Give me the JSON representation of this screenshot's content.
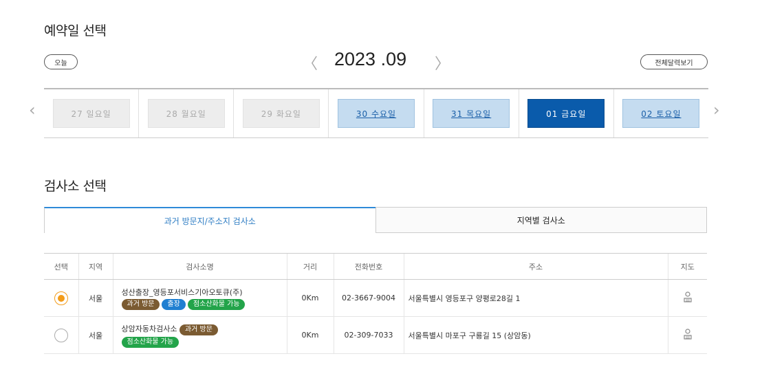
{
  "date_section": {
    "title": "예약일 선택",
    "today_button": "오늘",
    "month_label": "2023 .09",
    "prev_month_glyph": "〈",
    "next_month_glyph": "〉",
    "full_calendar_button": "전체달력보기",
    "days": [
      {
        "label": "27  일요일",
        "state": "past"
      },
      {
        "label": "28  월요일",
        "state": "past"
      },
      {
        "label": "29  화요일",
        "state": "past"
      },
      {
        "label": "30  수요일",
        "state": "available"
      },
      {
        "label": "31  목요일",
        "state": "available"
      },
      {
        "label": "01  금요일",
        "state": "selected"
      },
      {
        "label": "02  토요일",
        "state": "available"
      }
    ]
  },
  "center_section": {
    "title": "검사소 선택",
    "tabs": [
      {
        "label": "과거 방문지/주소지 검사소",
        "active": true
      },
      {
        "label": "지역별 검사소",
        "active": false
      }
    ],
    "columns": [
      "선택",
      "지역",
      "검사소명",
      "거리",
      "전화번호",
      "주소",
      "지도"
    ],
    "rows": [
      {
        "selected": true,
        "region": "서울",
        "name": "성산출장_영등포서비스기아오토큐(주)",
        "badges": [
          {
            "text": "과거 방문",
            "kind": "past"
          },
          {
            "text": "출장",
            "kind": "trip"
          },
          {
            "text": "점소산화물 가능",
            "kind": "fire"
          }
        ],
        "distance": "0Km",
        "phone": "02-3667-9004",
        "address": "서울특별시 영등포구 양평로28길 1",
        "map_icon": "map-person-icon"
      },
      {
        "selected": false,
        "region": "서울",
        "name": "상암자동차검사소",
        "badges": [
          {
            "text": "과거 방문",
            "kind": "past"
          },
          {
            "text": "점소산화물 가능",
            "kind": "fire"
          }
        ],
        "distance": "0Km",
        "phone": "02-309-7033",
        "address": "서울특별시 마포구 구룡길 15 (상암동)",
        "map_icon": "map-person-icon"
      }
    ]
  },
  "colors": {
    "selected_day": "#0a5bab",
    "available_day": "#c5dcf0",
    "radio_on": "#f39c1a",
    "badge_past": "#7b5b32",
    "badge_trip": "#1f7fd1",
    "badge_fire": "#23a44a",
    "active_tab": "#2e8ad8"
  }
}
